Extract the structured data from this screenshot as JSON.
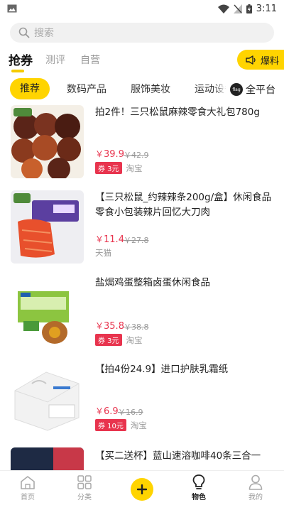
{
  "status_bar": {
    "time": "3:11"
  },
  "search": {
    "placeholder": "搜索"
  },
  "top_tabs": [
    {
      "label": "抢券",
      "active": true
    },
    {
      "label": "测评",
      "active": false
    },
    {
      "label": "自营",
      "active": false
    }
  ],
  "baoliao": {
    "label": "爆料"
  },
  "categories": [
    {
      "label": "推荐",
      "active": true
    },
    {
      "label": "数码产品",
      "active": false
    },
    {
      "label": "服饰美妆",
      "active": false
    },
    {
      "label": "运动设备",
      "active": false
    }
  ],
  "all_platform": {
    "label": "全平台",
    "icon_text": "flag"
  },
  "products": [
    {
      "title": "拍2件！三只松鼠麻辣零食大礼包780g",
      "price": "39.9",
      "original": "42.9",
      "coupon": "券 3元",
      "platform": "淘宝"
    },
    {
      "title": "【三只松鼠_约辣辣条200g/盒】休闲食品零食小包装辣片回忆大刀肉",
      "price": "11.4",
      "original": "27.8",
      "coupon": "",
      "platform": "天猫"
    },
    {
      "title": "盐焗鸡蛋整箱卤蛋休闲食品",
      "price": "35.8",
      "original": "38.8",
      "coupon": "券 3元",
      "platform": "淘宝"
    },
    {
      "title": "【拍4份24.9】进口护肤乳霜纸",
      "price": "6.9",
      "original": "16.9",
      "coupon": "券 10元",
      "platform": "淘宝"
    },
    {
      "title": "【买二送杯】蓝山速溶咖啡40条三合一",
      "price": "",
      "original": "",
      "coupon": "",
      "platform": ""
    }
  ],
  "currency": "￥",
  "bottom_nav": [
    {
      "label": "首页",
      "icon": "home-icon",
      "active": false
    },
    {
      "label": "分类",
      "icon": "grid-icon",
      "active": false
    },
    {
      "label": "",
      "icon": "plus-icon",
      "active": false
    },
    {
      "label": "物色",
      "icon": "bulb-icon",
      "active": true
    },
    {
      "label": "我的",
      "icon": "user-icon",
      "active": false
    }
  ],
  "colors": {
    "accent": "#ffd400",
    "price": "#e8344e"
  }
}
